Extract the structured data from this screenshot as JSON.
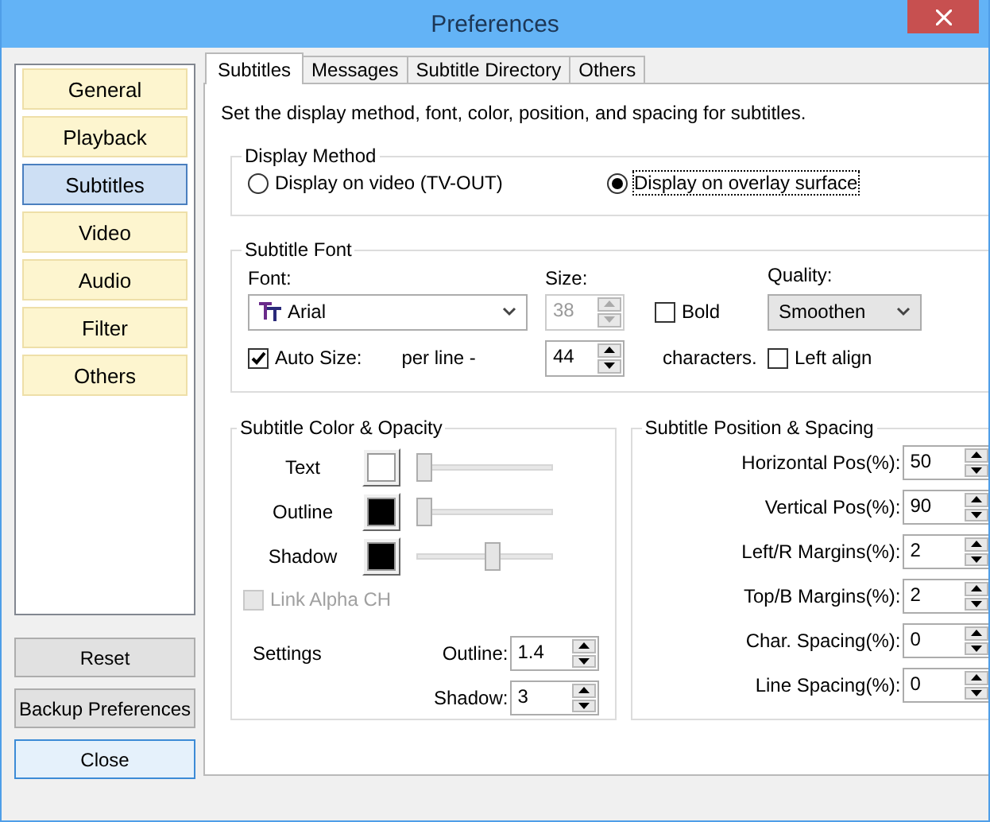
{
  "window": {
    "title": "Preferences"
  },
  "sidebar": {
    "items": [
      {
        "label": "General",
        "selected": false
      },
      {
        "label": "Playback",
        "selected": false
      },
      {
        "label": "Subtitles",
        "selected": true
      },
      {
        "label": "Video",
        "selected": false
      },
      {
        "label": "Audio",
        "selected": false
      },
      {
        "label": "Filter",
        "selected": false
      },
      {
        "label": "Others",
        "selected": false
      }
    ]
  },
  "buttons": [
    {
      "label": "Reset",
      "default": false
    },
    {
      "label": "Backup Preferences",
      "default": false
    },
    {
      "label": "Close",
      "default": true
    }
  ],
  "tabs": [
    {
      "label": "Subtitles",
      "selected": true
    },
    {
      "label": "Messages",
      "selected": false
    },
    {
      "label": "Subtitle Directory",
      "selected": false
    },
    {
      "label": "Others",
      "selected": false
    }
  ],
  "description": "Set the display method, font, color, position, and spacing for subtitles.",
  "display_method": {
    "title": "Display Method",
    "options": [
      {
        "label": "Display on video (TV-OUT)",
        "selected": false
      },
      {
        "label": "Display on overlay surface",
        "selected": true
      }
    ]
  },
  "subtitle_font": {
    "title": "Subtitle Font",
    "font_label": "Font:",
    "font_value": "Arial",
    "size_label": "Size:",
    "size": {
      "value": "38",
      "disabled": true
    },
    "bold": {
      "label": "Bold",
      "checked": false
    },
    "quality_label": "Quality:",
    "quality_value": "Smoothen",
    "auto_size": {
      "label": "Auto Size:",
      "checked": true
    },
    "per_line_label": "per line -",
    "per_line": {
      "value": "44",
      "disabled": false
    },
    "characters_label": "characters.",
    "left_align": {
      "label": "Left align",
      "checked": false
    }
  },
  "color_opacity": {
    "title": "Subtitle Color & Opacity",
    "rows": [
      {
        "label": "Text",
        "color": "#ffffff",
        "level": 0.0
      },
      {
        "label": "Outline",
        "color": "#000000",
        "level": 0.0
      },
      {
        "label": "Shadow",
        "color": "#000000",
        "level": 0.57
      }
    ],
    "link_alpha": {
      "label": "Link Alpha CH",
      "checked": false,
      "disabled": true
    },
    "settings_label": "Settings",
    "settings": [
      {
        "label": "Outline:",
        "value": "1.4"
      },
      {
        "label": "Shadow:",
        "value": "3"
      }
    ]
  },
  "position_spacing": {
    "title": "Subtitle Position & Spacing",
    "fields": [
      {
        "label": "Horizontal Pos(%):",
        "value": "50"
      },
      {
        "label": "Vertical Pos(%):",
        "value": "90"
      },
      {
        "label": "Left/R Margins(%):",
        "value": "2"
      },
      {
        "label": "Top/B Margins(%):",
        "value": "2"
      },
      {
        "label": "Char. Spacing(%):",
        "value": "0"
      },
      {
        "label": "Line Spacing(%):",
        "value": "0"
      }
    ]
  }
}
